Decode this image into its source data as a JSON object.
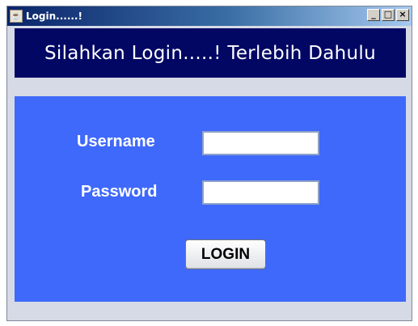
{
  "window": {
    "title": "Login......!",
    "icon": "java-cup-icon",
    "controls": [
      "minimize-icon",
      "maximize-icon",
      "close-icon"
    ],
    "minimize_glyph": "_",
    "maximize_glyph": "□",
    "close_glyph": "×"
  },
  "header": {
    "text": "Silahkan Login.....! Terlebih Dahulu",
    "background": "#020764"
  },
  "form": {
    "background": "#3f69fb",
    "username_label": "Username",
    "username_value": "",
    "password_label": "Password",
    "password_value": "",
    "login_label": "LOGIN"
  }
}
